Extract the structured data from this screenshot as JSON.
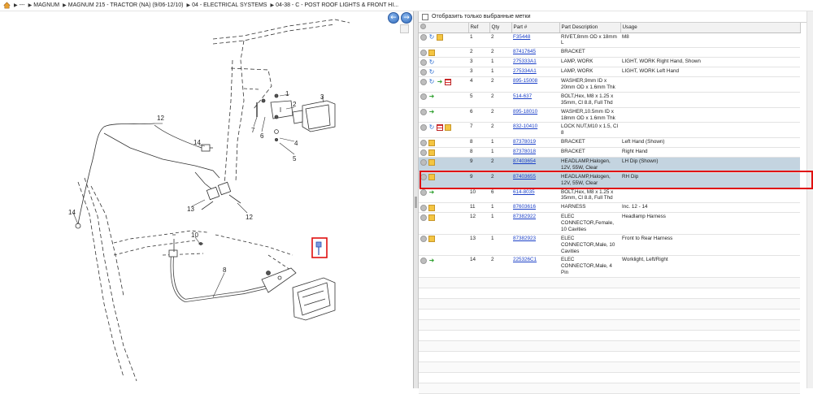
{
  "breadcrumb": [
    "---",
    "MAGNUM",
    "MAGNUM 215 - TRACTOR (NA) (9/06-12/10)",
    "04 - ELECTRICAL SYSTEMS",
    "04-38 - C - POST ROOF LIGHTS & FRONT HI..."
  ],
  "diagram_labels": [
    "1",
    "2",
    "3",
    "4",
    "5",
    "6",
    "7",
    "8",
    "10",
    "11",
    "12",
    "13",
    "14",
    "14"
  ],
  "filter_label": "Отобразить только выбранные метки",
  "columns": [
    "Ref",
    "Qty",
    "Part #",
    "Part Description",
    "Usage"
  ],
  "rows": [
    {
      "ref": "1",
      "qty": "2",
      "part": "F35448",
      "desc": "RIVET,8mm OD x 18mm L",
      "usage": "M8",
      "icons": [
        "circle",
        "blue",
        "box"
      ]
    },
    {
      "ref": "2",
      "qty": "2",
      "part": "87417645",
      "desc": "BRACKET",
      "usage": "",
      "icons": [
        "circle",
        "box"
      ]
    },
    {
      "ref": "3",
      "qty": "1",
      "part": "275333A1",
      "desc": "LAMP, WORK",
      "usage": "LIGHT, WORK Right Hand, Shown",
      "icons": [
        "circle",
        "blue"
      ]
    },
    {
      "ref": "3",
      "qty": "1",
      "part": "275334A1",
      "desc": "LAMP, WORK",
      "usage": "LIGHT, WORK Left Hand",
      "icons": [
        "circle",
        "blue"
      ]
    },
    {
      "ref": "4",
      "qty": "2",
      "part": "895-15008",
      "desc": "WASHER,9mm ID x 20mm OD x 1.6mm Thk",
      "usage": "",
      "icons": [
        "circle",
        "blue",
        "green",
        "stack"
      ]
    },
    {
      "ref": "5",
      "qty": "2",
      "part": "514-637",
      "desc": "BOLT,Hex, M8 x 1.25 x 35mm, Cl 8.8, Full Thd",
      "usage": "",
      "icons": [
        "circle",
        "green"
      ]
    },
    {
      "ref": "6",
      "qty": "2",
      "part": "895-18010",
      "desc": "WASHER,10.5mm ID x 18mm OD x 1.6mm Thk",
      "usage": "",
      "icons": [
        "circle",
        "green"
      ]
    },
    {
      "ref": "7",
      "qty": "2",
      "part": "832-10410",
      "desc": "LOCK NUT,M10 x 1.5, Cl 8",
      "usage": "",
      "icons": [
        "circle",
        "blue",
        "stack",
        "box"
      ]
    },
    {
      "ref": "8",
      "qty": "1",
      "part": "87378019",
      "desc": "BRACKET",
      "usage": "Left Hand (Shown)",
      "icons": [
        "circle",
        "box"
      ]
    },
    {
      "ref": "8",
      "qty": "1",
      "part": "87378018",
      "desc": "BRACKET",
      "usage": "Right Hand",
      "icons": [
        "circle",
        "box"
      ]
    },
    {
      "ref": "9",
      "qty": "2",
      "part": "87403654",
      "desc": "HEADLAMP,Halogen, 12V, 55W, Clear",
      "usage": "LH Dip (Shown)",
      "icons": [
        "circle",
        "box"
      ],
      "highlight": true
    },
    {
      "ref": "9",
      "qty": "2",
      "part": "87403655",
      "desc": "HEADLAMP,Halogen, 12V, 55W, Clear",
      "usage": "RH Dip",
      "icons": [
        "circle",
        "box"
      ],
      "highlight": true,
      "selected": true
    },
    {
      "ref": "10",
      "qty": "6",
      "part": "614-8035",
      "desc": "BOLT,Hex, M8 x 1.25 x 35mm, Cl 8.8, Full Thd",
      "usage": "",
      "icons": [
        "circle",
        "green"
      ]
    },
    {
      "ref": "11",
      "qty": "1",
      "part": "87603616",
      "desc": "HARNESS",
      "usage": "Inc. 12 - 14",
      "icons": [
        "circle",
        "box"
      ]
    },
    {
      "ref": "12",
      "qty": "1",
      "part": "87382922",
      "desc": "ELEC CONNECTOR,Female, 10 Cavities",
      "usage": "Headlamp Harness",
      "icons": [
        "circle",
        "box"
      ]
    },
    {
      "ref": "13",
      "qty": "1",
      "part": "87382923",
      "desc": "ELEC CONNECTOR,Male, 10 Cavities",
      "usage": "Front to Rear Harness",
      "icons": [
        "circle",
        "box"
      ]
    },
    {
      "ref": "14",
      "qty": "2",
      "part": "225326C1",
      "desc": "ELEC CONNECTOR,Male, 4 Pin",
      "usage": "Worklight, Left/Right",
      "icons": [
        "circle",
        "green"
      ]
    }
  ]
}
